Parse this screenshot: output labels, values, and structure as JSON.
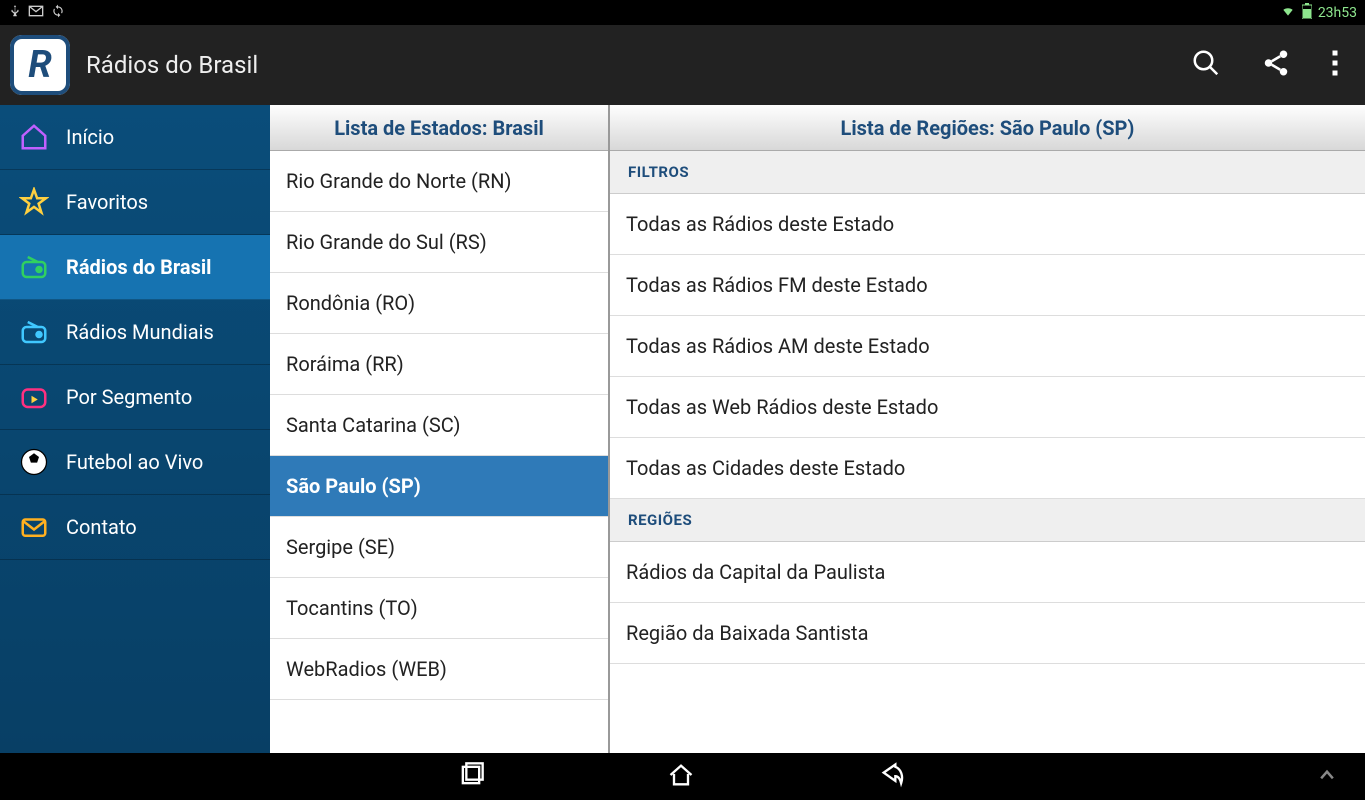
{
  "status": {
    "time": "23h53"
  },
  "app": {
    "title": "Rádios do Brasil"
  },
  "sidebar": {
    "items": [
      {
        "label": "Início"
      },
      {
        "label": "Favoritos"
      },
      {
        "label": "Rádios do Brasil"
      },
      {
        "label": "Rádios Mundiais"
      },
      {
        "label": "Por Segmento"
      },
      {
        "label": "Futebol ao Vivo"
      },
      {
        "label": "Contato"
      }
    ]
  },
  "states": {
    "header": "Lista de Estados: Brasil",
    "items": [
      "Rio Grande do Norte (RN)",
      "Rio Grande do Sul (RS)",
      "Rondônia (RO)",
      "Roráima (RR)",
      "Santa Catarina (SC)",
      "São Paulo (SP)",
      "Sergipe (SE)",
      "Tocantins (TO)",
      "WebRadios (WEB)"
    ]
  },
  "regions": {
    "header": "Lista de Regiões: São Paulo (SP)",
    "filtros_label": "FILTROS",
    "filtros": [
      "Todas as Rádios deste Estado",
      "Todas as Rádios FM deste Estado",
      "Todas as Rádios AM deste Estado",
      "Todas as Web Rádios deste Estado",
      "Todas as Cidades deste Estado"
    ],
    "regioes_label": "REGIÕES",
    "regioes": [
      "Rádios da Capital da Paulista",
      "Região da Baixada Santista"
    ]
  }
}
